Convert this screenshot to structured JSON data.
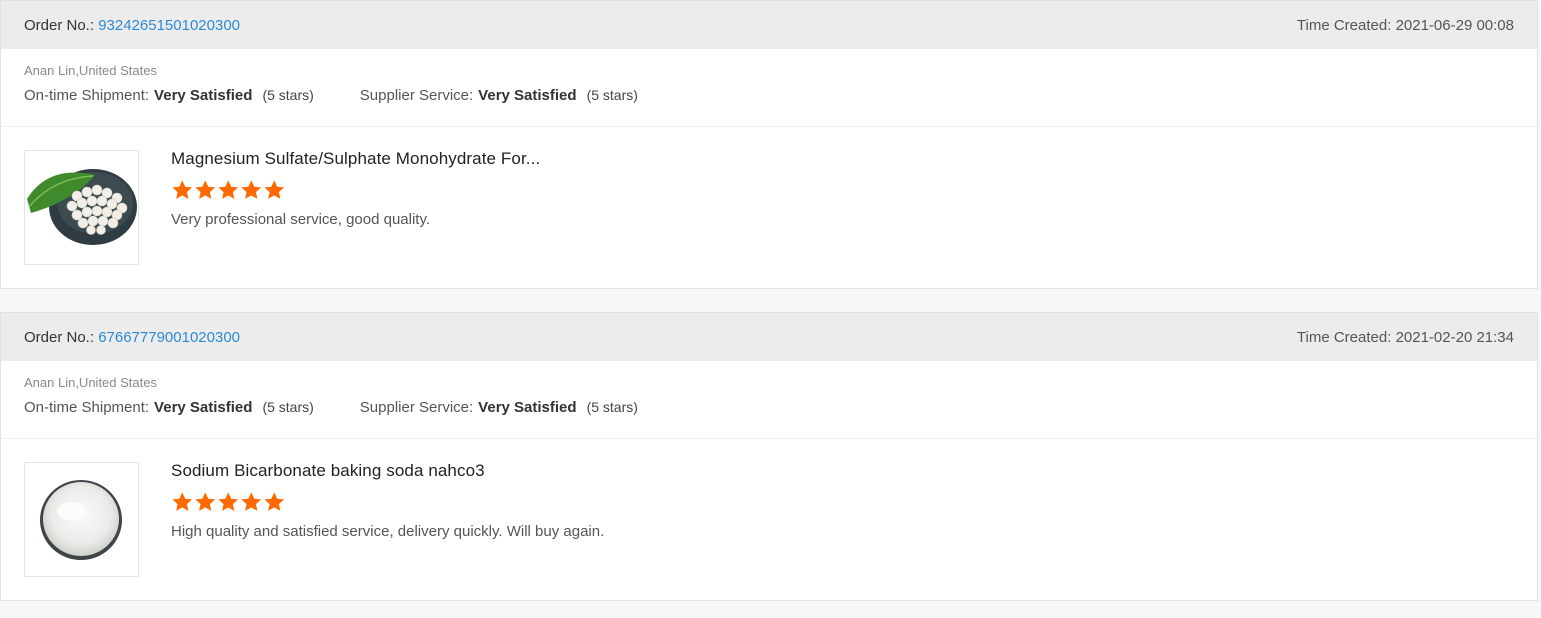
{
  "labels": {
    "order_no": "Order No.:",
    "time_created": "Time Created:",
    "on_time_shipment": "On-time Shipment:",
    "supplier_service": "Supplier Service:"
  },
  "colors": {
    "link": "#2a8ad4",
    "star": "#ff6a00",
    "header_bg": "#ececec"
  },
  "reviews": [
    {
      "order_number": "93242651501020300",
      "time_created": "2021-06-29 00:08",
      "buyer": "Anan Lin,United States",
      "on_time_shipment": "Very Satisfied",
      "on_time_shipment_stars": "(5 stars)",
      "supplier_service": "Very Satisfied",
      "supplier_service_stars": "(5 stars)",
      "product_title": "Magnesium Sulfate/Sulphate Monohydrate For...",
      "rating": 5,
      "comment": "Very professional service, good quality.",
      "image_icon": "magnesium-sulfate-product-image"
    },
    {
      "order_number": "67667779001020300",
      "time_created": "2021-02-20 21:34",
      "buyer": "Anan Lin,United States",
      "on_time_shipment": "Very Satisfied",
      "on_time_shipment_stars": "(5 stars)",
      "supplier_service": "Very Satisfied",
      "supplier_service_stars": "(5 stars)",
      "product_title": "Sodium Bicarbonate baking soda nahco3",
      "rating": 5,
      "comment": "High quality and satisfied service, delivery quickly. Will buy again.",
      "image_icon": "baking-soda-product-image"
    }
  ]
}
